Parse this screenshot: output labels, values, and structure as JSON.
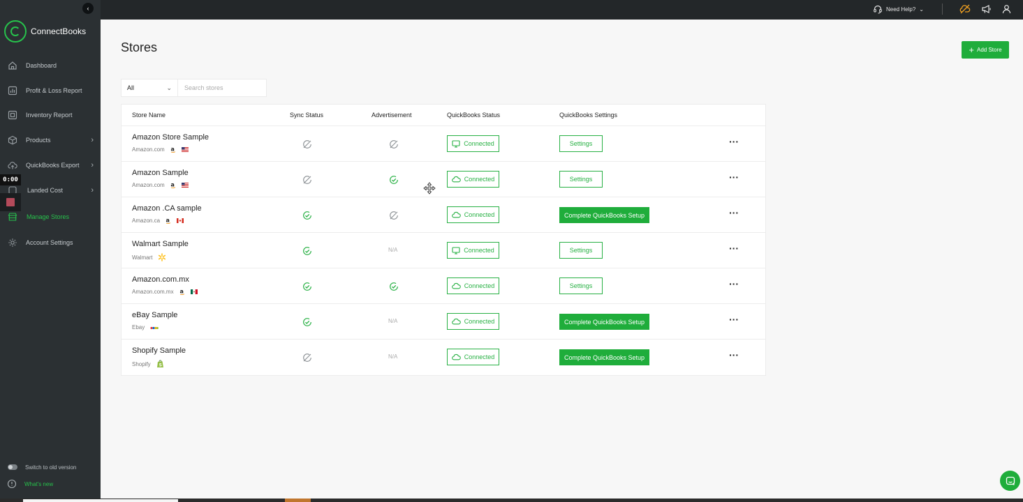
{
  "app": {
    "logo_text": "ConnectBooks",
    "accent_color": "#1fad3b"
  },
  "sidebar": {
    "items": [
      {
        "label": "Dashboard",
        "icon": "home-icon"
      },
      {
        "label": "Profit & Loss Report",
        "icon": "chart-icon"
      },
      {
        "label": "Inventory Report",
        "icon": "inventory-icon"
      },
      {
        "label": "Products",
        "icon": "box-icon",
        "has_submenu": true
      },
      {
        "label": "QuickBooks Export",
        "icon": "cloud-upload-icon",
        "has_submenu": true
      },
      {
        "label": "Landed Cost",
        "icon": "cost-icon",
        "has_submenu": true
      },
      {
        "label": "Manage Stores",
        "icon": "store-icon",
        "active": true
      },
      {
        "label": "Account Settings",
        "icon": "gear-icon"
      }
    ],
    "switch_label": "Switch to old version",
    "whats_new_label": "What's new"
  },
  "recorder": {
    "time": "0:00"
  },
  "topbar": {
    "help_label": "Need Help?"
  },
  "page": {
    "title": "Stores",
    "add_button_label": "Add Store"
  },
  "filter": {
    "selected": "All",
    "search_placeholder": "Search stores"
  },
  "table": {
    "headers": {
      "store_name": "Store Name",
      "sync_status": "Sync Status",
      "advertisement": "Advertisement",
      "qb_status": "QuickBooks Status",
      "qb_settings": "QuickBooks Settings"
    },
    "rows": [
      {
        "name": "Amazon Store Sample",
        "marketplace": "Amazon.com",
        "mk_icon": "amazon",
        "flag": "us",
        "sync": "off",
        "ad": "off",
        "qb_status": "Connected",
        "qb_status_icon": "monitor",
        "action": "Settings",
        "action_type": "settings"
      },
      {
        "name": "Amazon Sample",
        "marketplace": "Amazon.com",
        "mk_icon": "amazon",
        "flag": "us",
        "sync": "off",
        "ad": "on",
        "qb_status": "Connected",
        "qb_status_icon": "cloud",
        "action": "Settings",
        "action_type": "settings"
      },
      {
        "name": "Amazon .CA sample",
        "marketplace": "Amazon.ca",
        "mk_icon": "amazon",
        "flag": "ca",
        "sync": "on",
        "ad": "off",
        "qb_status": "Connected",
        "qb_status_icon": "cloud",
        "action": "Complete QuickBooks Setup",
        "action_type": "setup"
      },
      {
        "name": "Walmart Sample",
        "marketplace": "Walmart",
        "mk_icon": "walmart",
        "flag": "",
        "sync": "on",
        "ad": "N/A",
        "qb_status": "Connected",
        "qb_status_icon": "monitor",
        "action": "Settings",
        "action_type": "settings"
      },
      {
        "name": "Amazon.com.mx",
        "marketplace": "Amazon.com.mx",
        "mk_icon": "amazon",
        "flag": "mx",
        "sync": "on",
        "ad": "on",
        "qb_status": "Connected",
        "qb_status_icon": "cloud",
        "action": "Settings",
        "action_type": "settings"
      },
      {
        "name": "eBay Sample",
        "marketplace": "Ebay",
        "mk_icon": "ebay",
        "flag": "",
        "sync": "on",
        "ad": "N/A",
        "qb_status": "Connected",
        "qb_status_icon": "cloud",
        "action": "Complete QuickBooks Setup",
        "action_type": "setup"
      },
      {
        "name": "Shopify Sample",
        "marketplace": "Shopify",
        "mk_icon": "shopify",
        "flag": "",
        "sync": "off",
        "ad": "N/A",
        "qb_status": "Connected",
        "qb_status_icon": "cloud",
        "action": "Complete QuickBooks Setup",
        "action_type": "setup"
      }
    ]
  }
}
